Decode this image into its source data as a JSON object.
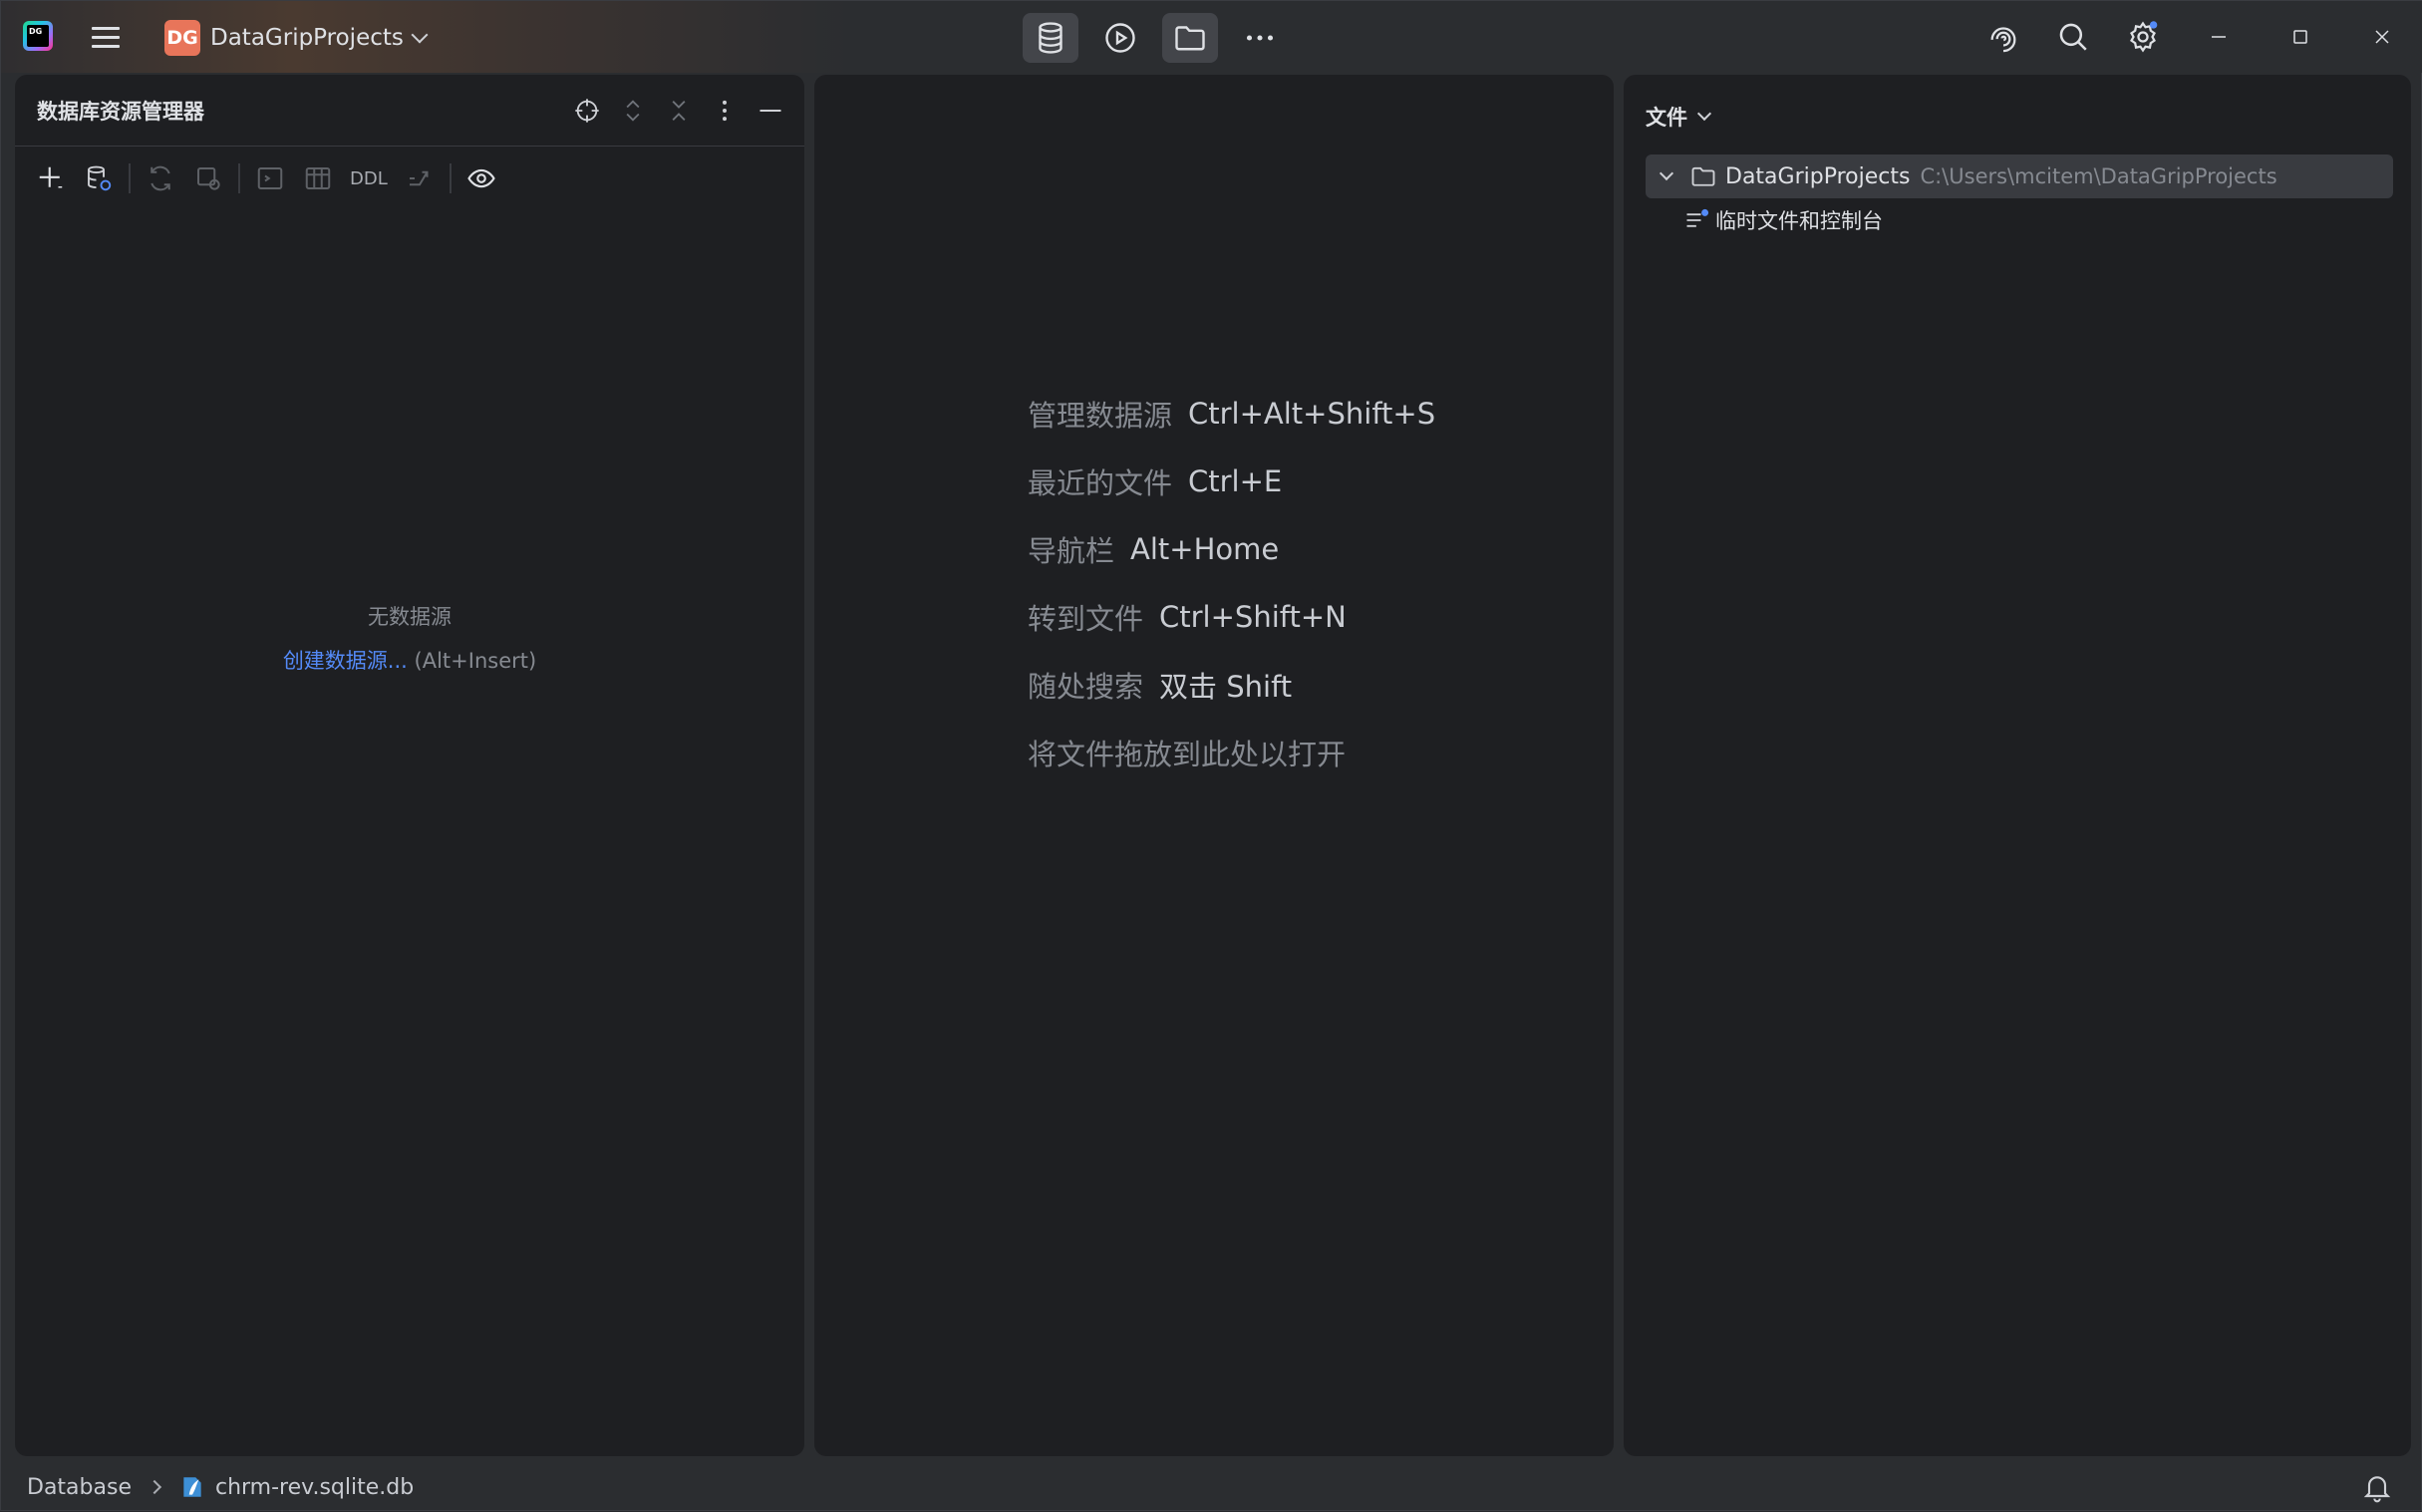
{
  "titlebar": {
    "app_logo_text": "DG",
    "project_badge": "DG",
    "project_name": "DataGripProjects"
  },
  "db_explorer": {
    "title": "数据库资源管理器",
    "toolbar_ddl": "DDL",
    "empty_title": "无数据源",
    "empty_link": "创建数据源...",
    "empty_shortcut": "(Alt+Insert)"
  },
  "center": {
    "hints": [
      {
        "label": "管理数据源",
        "key": "Ctrl+Alt+Shift+S"
      },
      {
        "label": "最近的文件",
        "key": "Ctrl+E"
      },
      {
        "label": "导航栏",
        "key": "Alt+Home"
      },
      {
        "label": "转到文件",
        "key": "Ctrl+Shift+N"
      },
      {
        "label": "随处搜索",
        "key": "双击 Shift"
      },
      {
        "label": "将文件拖放到此处以打开",
        "key": ""
      }
    ]
  },
  "files": {
    "title": "文件",
    "root_name": "DataGripProjects",
    "root_path": "C:\\Users\\mcitem\\DataGripProjects",
    "child_name": "临时文件和控制台"
  },
  "statusbar": {
    "crumb_root": "Database",
    "crumb_file": "chrm-rev.sqlite.db"
  },
  "icons": {
    "app": "datagrip-logo-icon",
    "menu": "hamburger-menu-icon",
    "database": "database-icon",
    "run": "run-icon",
    "folder": "folder-icon",
    "more": "more-horizontal-icon",
    "ai": "ai-assistant-icon",
    "search": "search-icon",
    "settings": "gear-icon",
    "bell": "notification-bell-icon"
  },
  "colors": {
    "accent_link": "#548af7",
    "project_badge": "#e8755a",
    "panel_bg": "#1e1f22",
    "window_bg": "#2b2d30"
  }
}
